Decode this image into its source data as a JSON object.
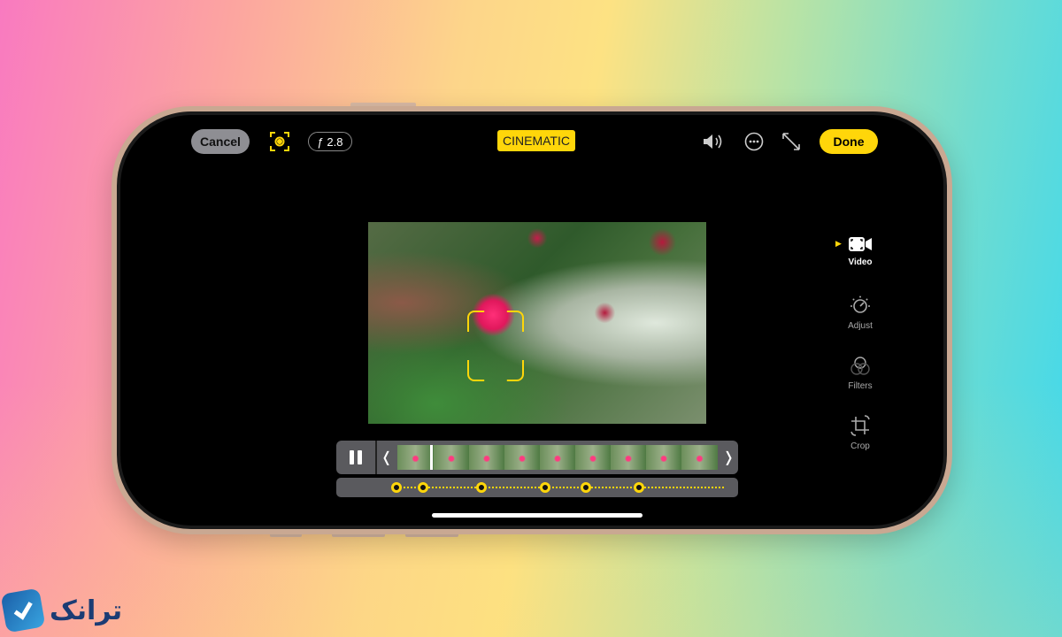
{
  "toolbar": {
    "cancel": "Cancel",
    "aperture": "ƒ 2.8",
    "mode": "CINEMATIC",
    "done": "Done"
  },
  "icons": {
    "focus": "focus-lock-icon",
    "volume": "speaker-icon",
    "more": "ellipsis-circle-icon",
    "expand": "expand-arrows-icon"
  },
  "sidebar": {
    "items": [
      {
        "label": "Video",
        "active": true
      },
      {
        "label": "Adjust"
      },
      {
        "label": "Filters"
      },
      {
        "label": "Crop"
      }
    ]
  },
  "timeline": {
    "keyframes": 6
  },
  "logo": {
    "text": "ترانک"
  },
  "colors": {
    "accent": "#ffd60a",
    "cancel_bg": "#8e8e93"
  }
}
